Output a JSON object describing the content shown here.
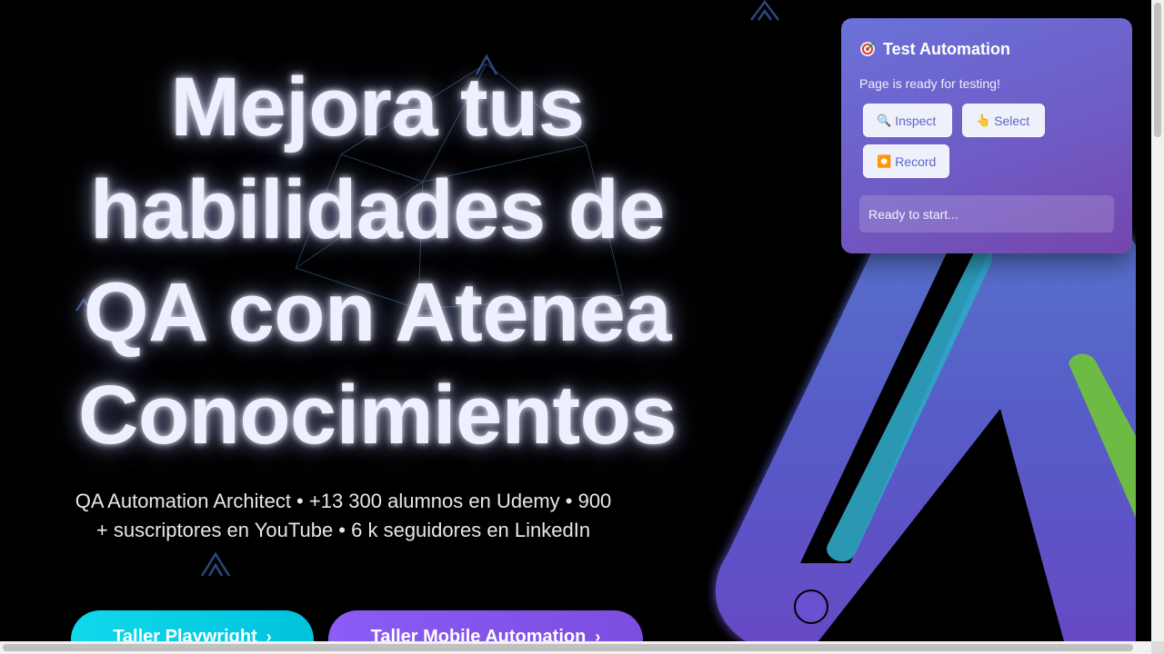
{
  "hero": {
    "title": "Mejora tus habilidades de QA con Atenea Conocimientos",
    "subtitle": "QA Automation Architect • +13 300 alumnos en Udemy • 900 + suscriptores en YouTube • 6 k seguidores en LinkedIn"
  },
  "cta": [
    {
      "label": "Taller Playwright",
      "icon": "arrow-right-icon"
    },
    {
      "label": "Taller Mobile Automation",
      "icon": "arrow-right-icon"
    }
  ],
  "panel": {
    "icon": "target-icon",
    "title": "Test Automation",
    "message": "Page is ready for testing!",
    "buttons": {
      "inspect": {
        "icon": "🔍",
        "label": "Inspect"
      },
      "select": {
        "icon": "👆",
        "label": "Select"
      },
      "record": {
        "icon": "⏺️",
        "label": "Record"
      }
    },
    "status": "Ready to start..."
  },
  "colors": {
    "background": "#000000",
    "cta_cyan": "#00c2dc",
    "cta_purple": "#8b5cf6",
    "panel_gradient_start": "#6a72d8",
    "panel_gradient_end": "#7546ac",
    "logo_blue": "#5b6fd8",
    "logo_green": "#6dbb45"
  }
}
